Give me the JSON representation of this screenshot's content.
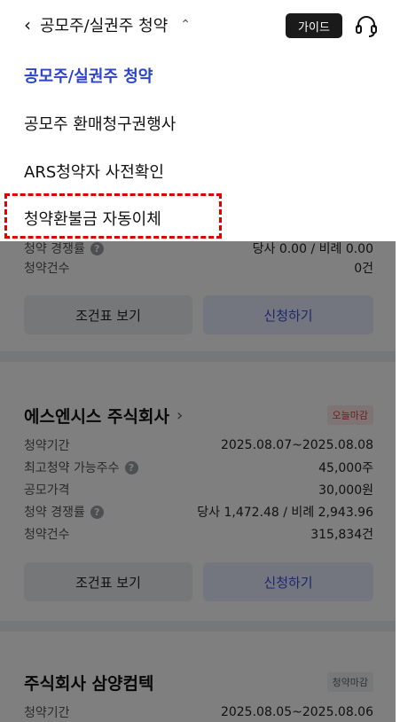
{
  "header": {
    "title": "공모주/실권주 청약",
    "guide_label": "가이드"
  },
  "menu": {
    "items": [
      {
        "label": "공모주/실권주 청약"
      },
      {
        "label": "공모주 환매청구권행사"
      },
      {
        "label": "ARS청약자 사전확인"
      },
      {
        "label": "청약환불금 자동이체"
      }
    ]
  },
  "card0": {
    "partial_label": "청약 경쟁률",
    "partial_value": "당사 0.00 / 비례 0.00",
    "count_label": "청약건수",
    "count_value": "0건",
    "btn_terms": "조건표 보기",
    "btn_apply": "신청하기"
  },
  "card1": {
    "name": "에스엔시스 주식회사",
    "badge": "오늘마감",
    "rows": [
      {
        "label": "청약기간",
        "value": "2025.08.07~2025.08.08"
      },
      {
        "label": "최고청약 가능주수",
        "value": "45,000주"
      },
      {
        "label": "공모가격",
        "value": "30,000원"
      },
      {
        "label": "청약 경쟁률",
        "value": "당사 1,472.48 / 비례 2,943.96"
      },
      {
        "label": "청약건수",
        "value": "315,834건"
      }
    ],
    "btn_terms": "조건표 보기",
    "btn_apply": "신청하기"
  },
  "card2": {
    "name": "주식회사 삼양컴텍",
    "badge": "청약마감",
    "rows": [
      {
        "label": "청약기간",
        "value": "2025.08.05~2025.08.06"
      }
    ]
  },
  "icons": {
    "back": "back-chevron-icon",
    "caret": "chevron-up-icon",
    "support": "headset-icon",
    "help": "question-icon"
  },
  "colors": {
    "active_menu": "#2c44c8",
    "highlight": "#e00000",
    "badge_red": "#e23b3b"
  }
}
